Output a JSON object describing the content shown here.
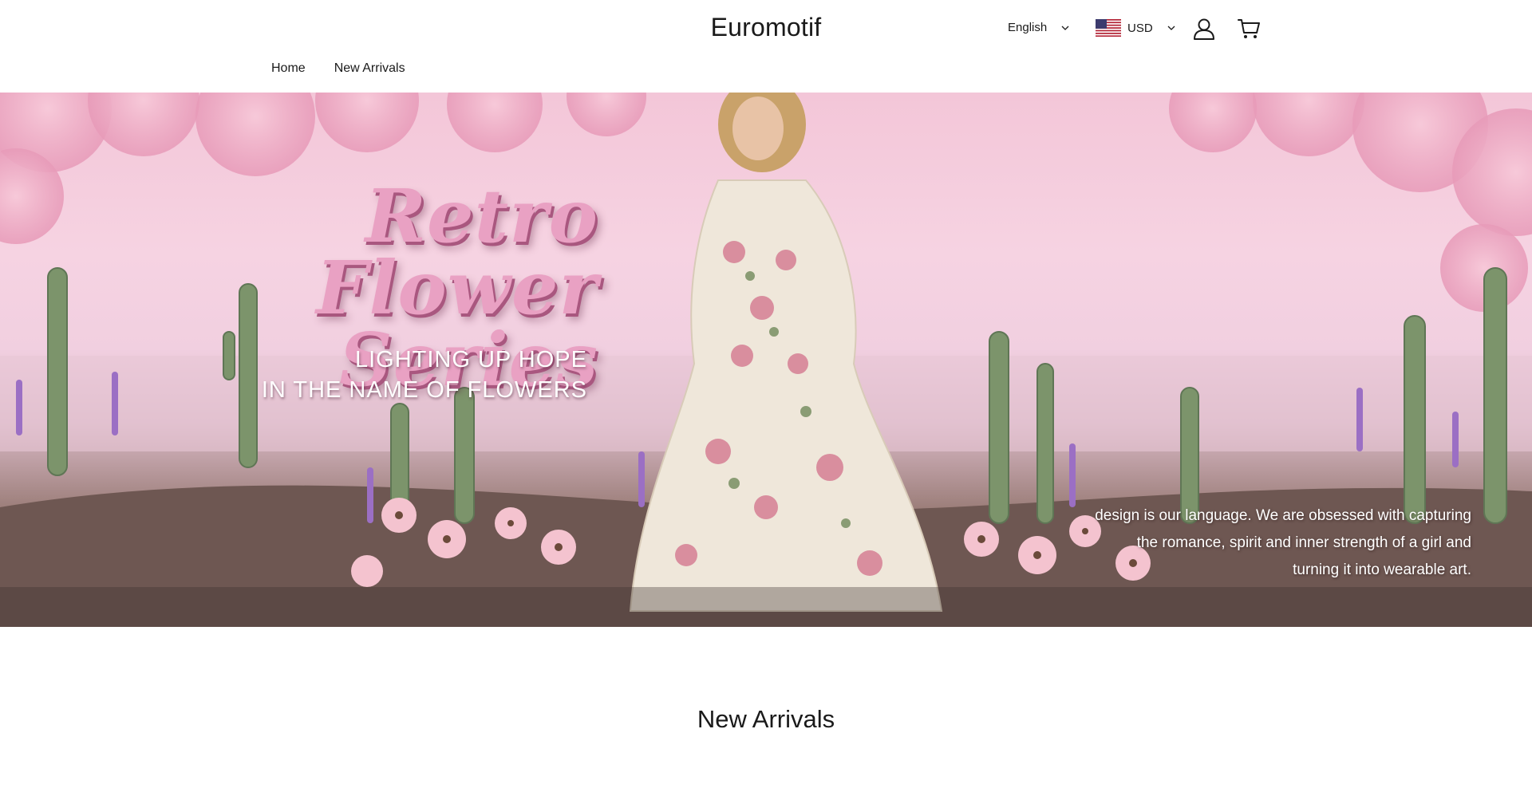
{
  "header": {
    "brand": "Euromotif",
    "language": {
      "label": "English",
      "icon": "chevron-down-icon"
    },
    "currency": {
      "label": "USD",
      "flag": "us-flag-icon",
      "icon": "chevron-down-icon"
    },
    "account_icon": "user-icon",
    "cart_icon": "cart-icon"
  },
  "nav": {
    "items": [
      {
        "label": "Home"
      },
      {
        "label": "New Arrivals"
      }
    ]
  },
  "hero": {
    "title_line1": "Retro Flower",
    "title_line2": "Series",
    "subtitle_line1": "LIGHTING UP HOPE",
    "subtitle_line2": "IN THE NAME OF FLOWERS",
    "copy_line1": "design is our language. We are obsessed with capturing",
    "copy_line2": "the romance, spirit and inner strength of a girl and",
    "copy_line3": "turning it into wearable art.",
    "colors": {
      "sky": "#f3c6d8",
      "title": "#e9a1c3",
      "ground": "#5b4742"
    }
  },
  "sections": {
    "new_arrivals_title": "New Arrivals"
  }
}
